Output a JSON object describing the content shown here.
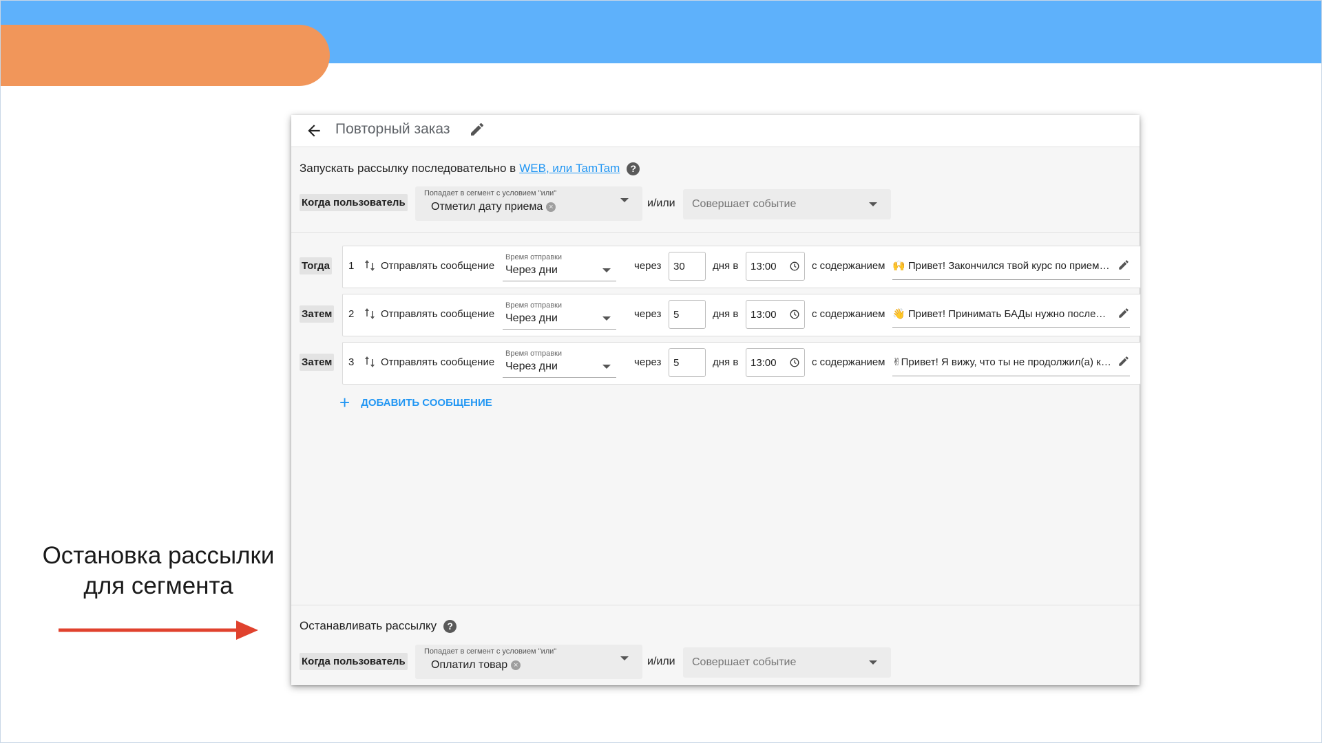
{
  "caption": {
    "line1": "Остановка рассылки",
    "line2": "для сегмента"
  },
  "header": {
    "title": "Повторный заказ"
  },
  "launch": {
    "text": "Запускать рассылку последовательно в",
    "link": "WEB, или TamTam",
    "help": "?"
  },
  "trigger": {
    "when_label": "Когда пользователь",
    "segment_label": "Попадает в сегмент с условием \"или\"",
    "segment_value": "Отметил дату приема",
    "chip_close": "×",
    "andor": "и/или",
    "event_placeholder": "Совершает событие"
  },
  "steps": [
    {
      "label": "Тогда",
      "num": "1",
      "action": "Отправлять сообщение",
      "timing_label": "Время отправки",
      "timing_value": "Через дни",
      "cherez": "через",
      "days": "30",
      "dnya": "дня в",
      "time": "13:00",
      "content_label": "с содержанием",
      "message": "🙌 Привет! Закончился твой курс по приему БАДов"
    },
    {
      "label": "Затем",
      "num": "2",
      "action": "Отправлять сообщение",
      "timing_label": "Время отправки",
      "timing_value": "Через дни",
      "cherez": "через",
      "days": "5",
      "dnya": "дня в",
      "time": "13:00",
      "content_label": "с содержанием",
      "message": "👋 Привет! Принимать БАДы нужно последовательно"
    },
    {
      "label": "Затем",
      "num": "3",
      "action": "Отправлять сообщение",
      "timing_label": "Время отправки",
      "timing_value": "Через дни",
      "cherez": "через",
      "days": "5",
      "dnya": "дня в",
      "time": "13:00",
      "content_label": "с содержанием",
      "message": "✌Привет! Я вижу, что ты не продолжил(а) курс"
    }
  ],
  "add_message": {
    "label": "ДОБАВИТЬ СООБЩЕНИЕ",
    "icon": "+"
  },
  "stop": {
    "title": "Останавливать рассылку",
    "help": "?",
    "when_label": "Когда пользователь",
    "segment_label": "Попадает в сегмент с условием \"или\"",
    "segment_value": "Оплатил товар",
    "chip_close": "×",
    "andor": "и/или",
    "event_placeholder": "Совершает событие"
  },
  "colors": {
    "top_band": "#5eb1fb",
    "orange_pill": "#f1965a",
    "arrow": "#e0422e",
    "link": "#2196f3"
  }
}
